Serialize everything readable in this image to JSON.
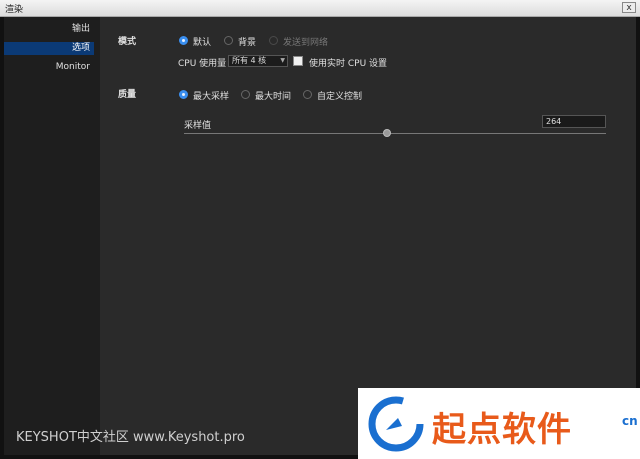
{
  "window": {
    "title": "渲染",
    "close_glyph": "x"
  },
  "sidebar": {
    "items": [
      {
        "label": "输出",
        "selected": false
      },
      {
        "label": "选项",
        "selected": true
      },
      {
        "label": "Monitor",
        "selected": false
      }
    ]
  },
  "mode": {
    "label": "模式",
    "options": [
      {
        "label": "默认",
        "selected": true,
        "enabled": true
      },
      {
        "label": "背景",
        "selected": false,
        "enabled": true
      },
      {
        "label": "发送到网络",
        "selected": false,
        "enabled": false
      }
    ],
    "cpu_label": "CPU 使用量",
    "cpu_value": "所有 4 核",
    "realtime_label": "使用实时 CPU 设置",
    "realtime_checked": false
  },
  "quality": {
    "label": "质量",
    "options": [
      {
        "label": "最大采样",
        "selected": true
      },
      {
        "label": "最大时间",
        "selected": false
      },
      {
        "label": "自定义控制",
        "selected": false
      }
    ],
    "samples_label": "采样值",
    "samples_value": "264",
    "slider_fraction": 0.48
  },
  "watermark": {
    "text": "KEYSHOT中文社区 www.Keyshot.pro"
  },
  "logo": {
    "text": "起点软件",
    "suffix": "cn"
  },
  "colors": {
    "accent": "#3a8ff0",
    "selection": "#0b3a76",
    "logo_orange": "#e85a1a",
    "logo_blue": "#1a6fd0"
  }
}
